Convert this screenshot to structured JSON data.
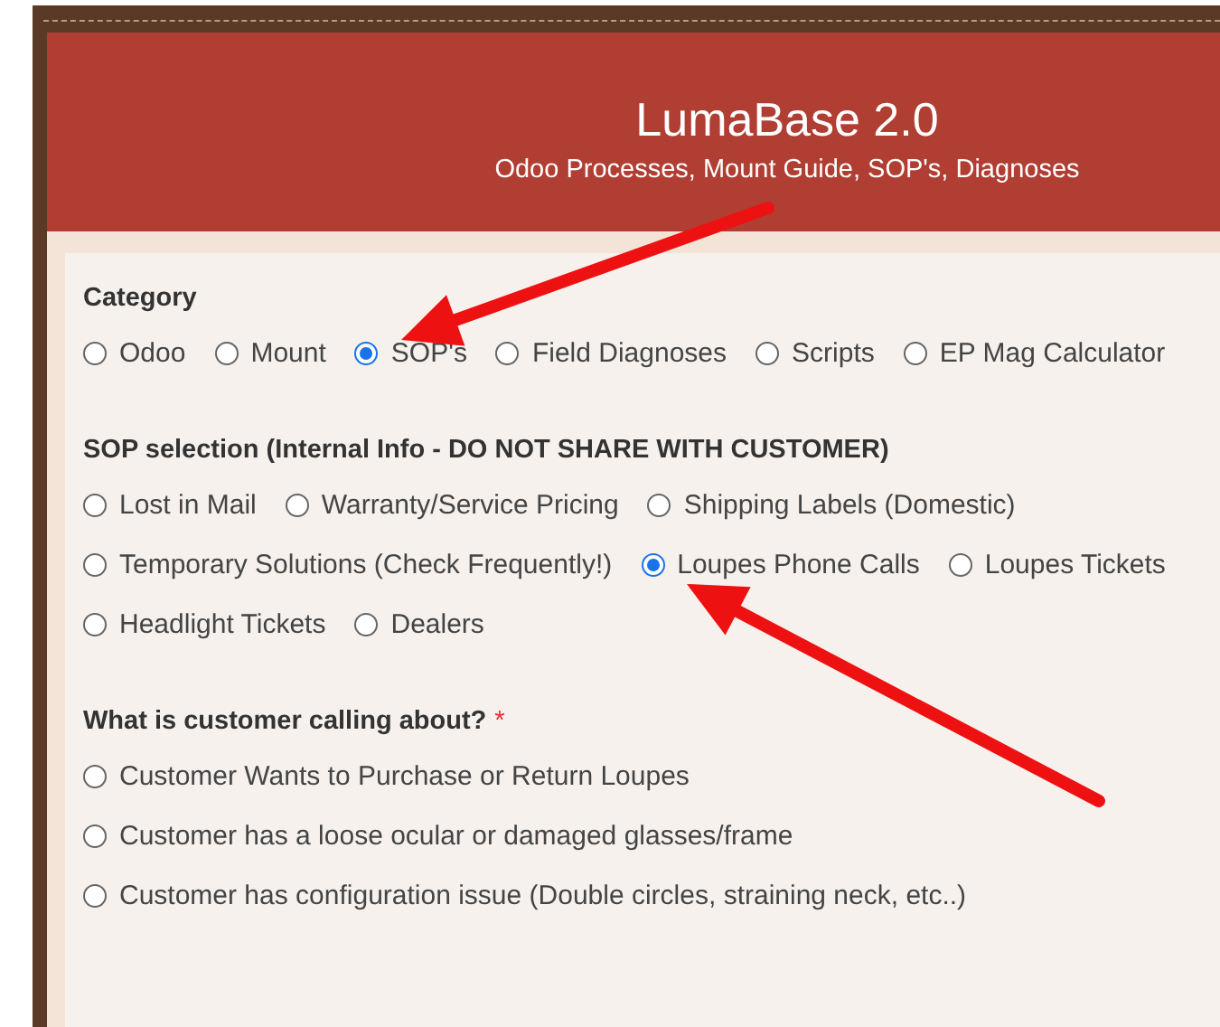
{
  "header": {
    "title": "LumaBase 2.0",
    "subtitle": "Odoo Processes, Mount Guide, SOP's, Diagnoses"
  },
  "groups": [
    {
      "label": "Category",
      "option_rows": [
        [
          {
            "label": "Odoo",
            "selected": false
          },
          {
            "label": "Mount",
            "selected": false
          },
          {
            "label": "SOP's",
            "selected": true
          },
          {
            "label": "Field Diagnoses",
            "selected": false
          },
          {
            "label": "Scripts",
            "selected": false
          },
          {
            "label": "EP Mag Calculator",
            "selected": false
          }
        ]
      ]
    },
    {
      "label": "SOP selection (Internal Info - DO NOT SHARE WITH CUSTOMER)",
      "option_rows": [
        [
          {
            "label": "Lost in Mail",
            "selected": false
          },
          {
            "label": "Warranty/Service Pricing",
            "selected": false
          },
          {
            "label": "Shipping Labels (Domestic)",
            "selected": false
          }
        ],
        [
          {
            "label": "Temporary Solutions (Check Frequently!)",
            "selected": false
          },
          {
            "label": "Loupes Phone Calls",
            "selected": true
          },
          {
            "label": "Loupes Tickets",
            "selected": false
          }
        ],
        [
          {
            "label": "Headlight Tickets",
            "selected": false
          },
          {
            "label": "Dealers",
            "selected": false
          }
        ]
      ]
    },
    {
      "label": "What is customer calling about?",
      "required_mark": "*",
      "option_rows": [
        [
          {
            "label": "Customer Wants to Purchase or Return Loupes",
            "selected": false
          }
        ],
        [
          {
            "label": "Customer has a loose ocular or damaged glasses/frame",
            "selected": false
          }
        ],
        [
          {
            "label": "Customer has configuration issue (Double circles, straining neck, etc..)",
            "selected": false
          }
        ]
      ]
    }
  ]
}
